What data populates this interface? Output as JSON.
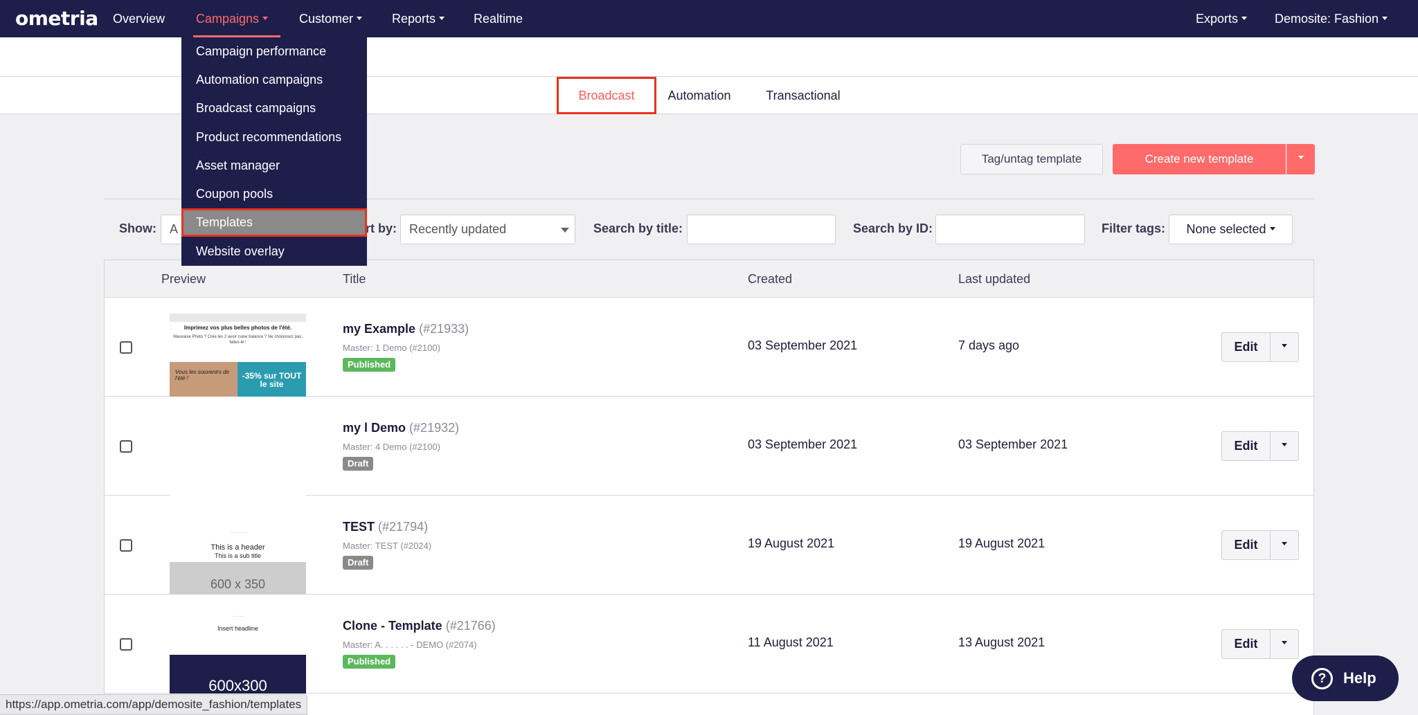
{
  "nav": {
    "logo": "ometria",
    "items": [
      "Overview",
      "Campaigns",
      "Customer",
      "Reports",
      "Realtime"
    ],
    "right": [
      "Exports",
      "Demosite: Fashion"
    ]
  },
  "colors": {
    "navy": "#1e1e4b",
    "accent": "#ff6b6b",
    "published": "#5cb85c",
    "draft": "#8a8a8a",
    "highlight": "#e8321e"
  },
  "tabs": [
    "Broadcast",
    "Automation",
    "Transactional"
  ],
  "actions": {
    "tag": "Tag/untag template",
    "create": "Create new template"
  },
  "filters": {
    "show_label": "Show:",
    "show_value": "A",
    "sort_label": "rt by:",
    "sort_value": "Recently updated",
    "search_title_label": "Search by title:",
    "search_id_label": "Search by ID:",
    "tags_label": "Filter tags:",
    "tags_value": "None selected"
  },
  "table": {
    "headers": {
      "preview": "Preview",
      "title": "Title",
      "created": "Created",
      "updated": "Last updated"
    },
    "edit_label": "Edit",
    "rows": [
      {
        "title": "my            Example",
        "id": "(#21933)",
        "master": "Master:           1 Demo (#2100)",
        "status": "Published",
        "created": "03 September 2021",
        "updated": "7 days ago"
      },
      {
        "title": "my          l Demo",
        "id": "(#21932)",
        "master": "Master:           4 Demo (#2100)",
        "status": "Draft",
        "created": "03 September 2021",
        "updated": "03 September 2021"
      },
      {
        "title": "TEST",
        "id": "(#21794)",
        "master": "Master: TEST (#2024)",
        "status": "Draft",
        "created": "19 August 2021",
        "updated": "19 August 2021"
      },
      {
        "title": "Clone -           Template",
        "id": "(#21766)",
        "master": "Master: A. . . . . . - DEMO (#2074)",
        "status": "Published",
        "created": "11 August 2021",
        "updated": "13 August 2021"
      }
    ]
  },
  "thumbs": {
    "t1_head": "Imprimez vos plus belles photos de l'été.",
    "t1_sub": "Mauvaise Photo ? Crée les 2 avoir cuise balance ? Ne choisissez pas, faites-lé !",
    "t1_left": "Vous les souvenirs de l'été !",
    "t1_right": "-35% sur TOUT le site",
    "t3_header": "This is a header",
    "t3_sub": "This is a sub title",
    "t3_block": "600 x 350",
    "t4_head": "Insert headline",
    "t4_block": "600x300"
  },
  "dropdown": [
    "Campaign performance",
    "Automation campaigns",
    "Broadcast campaigns",
    "Product recommendations",
    "Asset manager",
    "Coupon pools",
    "Templates",
    "Website overlay"
  ],
  "statusbar": "https://app.ometria.com/app/demosite_fashion/templates",
  "help": {
    "icon": "?",
    "label": "Help"
  }
}
